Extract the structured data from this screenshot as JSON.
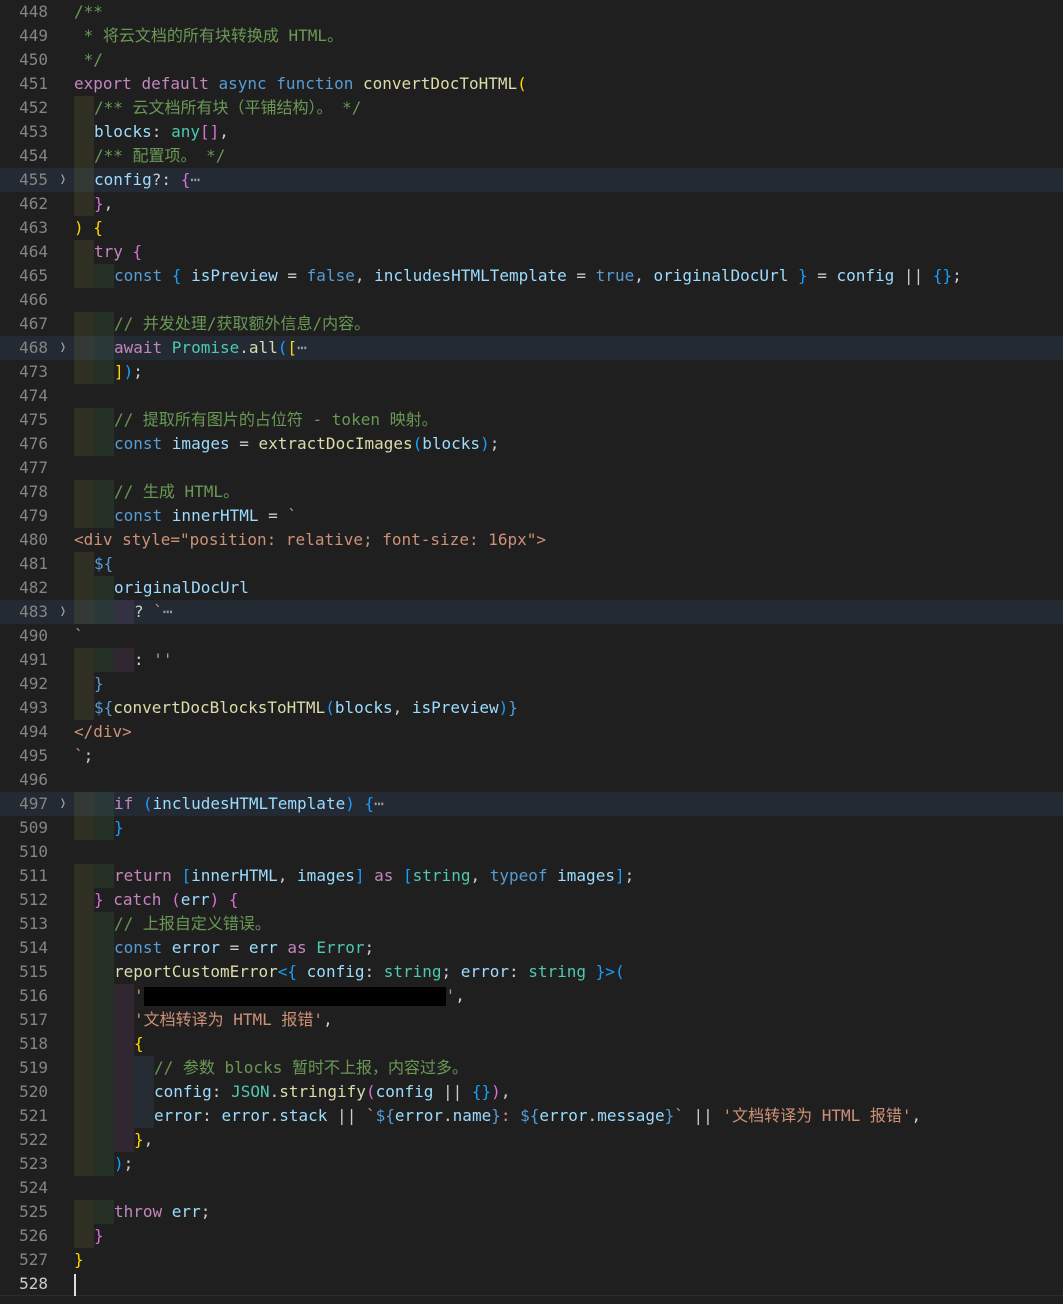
{
  "colors": {
    "background": "#1f1f1f",
    "keyword": "#c586c0",
    "keyword_blue": "#569cd6",
    "function": "#dcdcaa",
    "variable": "#9cdcfe",
    "type": "#4ec9b0",
    "string": "#ce9178",
    "comment": "#6a9955",
    "punct": "#cccccc",
    "bracket_gold": "#ffd700",
    "bracket_purple": "#da70d6",
    "bracket_blue": "#179fff",
    "tag": "#808080",
    "attr": "#9cdcfe"
  },
  "icons": {
    "fold": "chevron-right-icon",
    "folded_marker": "ellipsis-icon"
  },
  "lines": [
    {
      "n": "448",
      "fold": false,
      "indent": 0,
      "tokens": [
        [
          "/**",
          "comment"
        ]
      ]
    },
    {
      "n": "449",
      "fold": false,
      "indent": 0,
      "tokens": [
        [
          " * 将云文档的所有块转换成 HTML。",
          "comment"
        ]
      ]
    },
    {
      "n": "450",
      "fold": false,
      "indent": 0,
      "tokens": [
        [
          " */",
          "comment"
        ]
      ]
    },
    {
      "n": "451",
      "fold": false,
      "indent": 0,
      "tokens": [
        [
          "export ",
          "keyword"
        ],
        [
          "default ",
          "keyword"
        ],
        [
          "async ",
          "keyword_blue"
        ],
        [
          "function ",
          "keyword_blue"
        ],
        [
          "convertDocToHTML",
          "function"
        ],
        [
          "(",
          "bracket_gold"
        ]
      ]
    },
    {
      "n": "452",
      "fold": false,
      "indent": 1,
      "tokens": [
        [
          "/** 云文档所有块（平铺结构）。 */",
          "comment"
        ]
      ]
    },
    {
      "n": "453",
      "fold": false,
      "indent": 1,
      "tokens": [
        [
          "blocks",
          "variable"
        ],
        [
          ": ",
          "punct"
        ],
        [
          "any",
          "type"
        ],
        [
          "[]",
          "bracket_purple"
        ],
        [
          ",",
          "punct"
        ]
      ]
    },
    {
      "n": "454",
      "fold": false,
      "indent": 1,
      "tokens": [
        [
          "/** 配置项。 */",
          "comment"
        ]
      ]
    },
    {
      "n": "455",
      "fold": true,
      "indent": 1,
      "tokens": [
        [
          "config",
          "variable"
        ],
        [
          "?: ",
          "punct"
        ],
        [
          "{",
          "bracket_purple"
        ],
        [
          "⋯",
          "ellipsis"
        ]
      ]
    },
    {
      "n": "462",
      "fold": false,
      "indent": 1,
      "tokens": [
        [
          "}",
          "bracket_purple"
        ],
        [
          ",",
          "punct"
        ]
      ]
    },
    {
      "n": "463",
      "fold": false,
      "indent": 0,
      "tokens": [
        [
          ")",
          "bracket_gold"
        ],
        [
          " ",
          "punct"
        ],
        [
          "{",
          "bracket_gold"
        ]
      ]
    },
    {
      "n": "464",
      "fold": false,
      "indent": 1,
      "tokens": [
        [
          "try ",
          "keyword"
        ],
        [
          "{",
          "bracket_purple"
        ]
      ]
    },
    {
      "n": "465",
      "fold": false,
      "indent": 2,
      "tokens": [
        [
          "const ",
          "keyword_blue"
        ],
        [
          "{ ",
          "bracket_blue"
        ],
        [
          "isPreview",
          "variable"
        ],
        [
          " = ",
          "punct"
        ],
        [
          "false",
          "keyword_blue"
        ],
        [
          ", ",
          "punct"
        ],
        [
          "includesHTMLTemplate",
          "variable"
        ],
        [
          " = ",
          "punct"
        ],
        [
          "true",
          "keyword_blue"
        ],
        [
          ", ",
          "punct"
        ],
        [
          "originalDocUrl",
          "variable"
        ],
        [
          " }",
          "bracket_blue"
        ],
        [
          " = ",
          "punct"
        ],
        [
          "config",
          "variable"
        ],
        [
          " || ",
          "punct"
        ],
        [
          "{}",
          "bracket_blue"
        ],
        [
          ";",
          "punct"
        ]
      ]
    },
    {
      "n": "466",
      "fold": false,
      "indent": 0,
      "tokens": []
    },
    {
      "n": "467",
      "fold": false,
      "indent": 2,
      "tokens": [
        [
          "// 并发处理/获取额外信息/内容。",
          "comment"
        ]
      ]
    },
    {
      "n": "468",
      "fold": true,
      "indent": 2,
      "tokens": [
        [
          "await ",
          "keyword"
        ],
        [
          "Promise",
          "type"
        ],
        [
          ".",
          "punct"
        ],
        [
          "all",
          "function"
        ],
        [
          "(",
          "bracket_blue"
        ],
        [
          "[",
          "bracket_gold"
        ],
        [
          "⋯",
          "ellipsis"
        ]
      ]
    },
    {
      "n": "473",
      "fold": false,
      "indent": 2,
      "tokens": [
        [
          "]",
          "bracket_gold"
        ],
        [
          ")",
          "bracket_blue"
        ],
        [
          ";",
          "punct"
        ]
      ]
    },
    {
      "n": "474",
      "fold": false,
      "indent": 0,
      "tokens": []
    },
    {
      "n": "475",
      "fold": false,
      "indent": 2,
      "tokens": [
        [
          "// 提取所有图片的占位符 - token 映射。",
          "comment"
        ]
      ]
    },
    {
      "n": "476",
      "fold": false,
      "indent": 2,
      "tokens": [
        [
          "const ",
          "keyword_blue"
        ],
        [
          "images",
          "variable"
        ],
        [
          " = ",
          "punct"
        ],
        [
          "extractDocImages",
          "function"
        ],
        [
          "(",
          "bracket_blue"
        ],
        [
          "blocks",
          "variable"
        ],
        [
          ")",
          "bracket_blue"
        ],
        [
          ";",
          "punct"
        ]
      ]
    },
    {
      "n": "477",
      "fold": false,
      "indent": 0,
      "tokens": []
    },
    {
      "n": "478",
      "fold": false,
      "indent": 2,
      "tokens": [
        [
          "// 生成 HTML。",
          "comment"
        ]
      ]
    },
    {
      "n": "479",
      "fold": false,
      "indent": 2,
      "tokens": [
        [
          "const ",
          "keyword_blue"
        ],
        [
          "innerHTML",
          "variable"
        ],
        [
          " = ",
          "punct"
        ],
        [
          "`",
          "string"
        ]
      ]
    },
    {
      "n": "480",
      "fold": false,
      "indent": 0,
      "tokens": [
        [
          "<div style=\"position: relative; font-size: 16px\">",
          "string"
        ]
      ]
    },
    {
      "n": "481",
      "fold": false,
      "indent": 1,
      "tokens": [
        [
          "${",
          "keyword_blue"
        ]
      ]
    },
    {
      "n": "482",
      "fold": false,
      "indent": 2,
      "tokens": [
        [
          "originalDocUrl",
          "variable"
        ]
      ]
    },
    {
      "n": "483",
      "fold": true,
      "indent": 3,
      "tokens": [
        [
          "? ",
          "punct"
        ],
        [
          "`",
          "string"
        ],
        [
          "⋯",
          "ellipsis"
        ]
      ]
    },
    {
      "n": "490",
      "fold": false,
      "indent": 0,
      "tokens": [
        [
          "`",
          "string"
        ]
      ]
    },
    {
      "n": "491",
      "fold": false,
      "indent": 3,
      "tokens": [
        [
          ": ",
          "punct"
        ],
        [
          "''",
          "string"
        ]
      ]
    },
    {
      "n": "492",
      "fold": false,
      "indent": 1,
      "tokens": [
        [
          "}",
          "keyword_blue"
        ]
      ]
    },
    {
      "n": "493",
      "fold": false,
      "indent": 1,
      "tokens": [
        [
          "${",
          "keyword_blue"
        ],
        [
          "convertDocBlocksToHTML",
          "function"
        ],
        [
          "(",
          "bracket_blue"
        ],
        [
          "blocks",
          "variable"
        ],
        [
          ", ",
          "punct"
        ],
        [
          "isPreview",
          "variable"
        ],
        [
          ")",
          "bracket_blue"
        ],
        [
          "}",
          "keyword_blue"
        ]
      ]
    },
    {
      "n": "494",
      "fold": false,
      "indent": 0,
      "tokens": [
        [
          "</div>",
          "string"
        ]
      ]
    },
    {
      "n": "495",
      "fold": false,
      "indent": 0,
      "tokens": [
        [
          "`",
          "string"
        ],
        [
          ";",
          "punct"
        ]
      ]
    },
    {
      "n": "496",
      "fold": false,
      "indent": 0,
      "tokens": []
    },
    {
      "n": "497",
      "fold": true,
      "indent": 2,
      "tokens": [
        [
          "if ",
          "keyword"
        ],
        [
          "(",
          "bracket_blue"
        ],
        [
          "includesHTMLTemplate",
          "variable"
        ],
        [
          ") ",
          "bracket_blue"
        ],
        [
          "{",
          "bracket_blue"
        ],
        [
          "⋯",
          "ellipsis"
        ]
      ]
    },
    {
      "n": "509",
      "fold": false,
      "indent": 2,
      "tokens": [
        [
          "}",
          "bracket_blue"
        ]
      ]
    },
    {
      "n": "510",
      "fold": false,
      "indent": 0,
      "tokens": []
    },
    {
      "n": "511",
      "fold": false,
      "indent": 2,
      "tokens": [
        [
          "return ",
          "keyword"
        ],
        [
          "[",
          "bracket_blue"
        ],
        [
          "innerHTML",
          "variable"
        ],
        [
          ", ",
          "punct"
        ],
        [
          "images",
          "variable"
        ],
        [
          "]",
          "bracket_blue"
        ],
        [
          " as ",
          "keyword"
        ],
        [
          "[",
          "bracket_blue"
        ],
        [
          "string",
          "type"
        ],
        [
          ", ",
          "punct"
        ],
        [
          "typeof ",
          "keyword_blue"
        ],
        [
          "images",
          "variable"
        ],
        [
          "]",
          "bracket_blue"
        ],
        [
          ";",
          "punct"
        ]
      ]
    },
    {
      "n": "512",
      "fold": false,
      "indent": 1,
      "tokens": [
        [
          "} ",
          "bracket_purple"
        ],
        [
          "catch ",
          "keyword"
        ],
        [
          "(",
          "bracket_purple"
        ],
        [
          "err",
          "variable"
        ],
        [
          ") ",
          "bracket_purple"
        ],
        [
          "{",
          "bracket_purple"
        ]
      ]
    },
    {
      "n": "513",
      "fold": false,
      "indent": 2,
      "tokens": [
        [
          "// 上报自定义错误。",
          "comment"
        ]
      ]
    },
    {
      "n": "514",
      "fold": false,
      "indent": 2,
      "tokens": [
        [
          "const ",
          "keyword_blue"
        ],
        [
          "error",
          "variable"
        ],
        [
          " = ",
          "punct"
        ],
        [
          "err",
          "variable"
        ],
        [
          " as ",
          "keyword"
        ],
        [
          "Error",
          "type"
        ],
        [
          ";",
          "punct"
        ]
      ]
    },
    {
      "n": "515",
      "fold": false,
      "indent": 2,
      "tokens": [
        [
          "reportCustomError",
          "function"
        ],
        [
          "<{ ",
          "bracket_blue"
        ],
        [
          "config",
          "variable"
        ],
        [
          ": ",
          "punct"
        ],
        [
          "string",
          "type"
        ],
        [
          "; ",
          "punct"
        ],
        [
          "error",
          "variable"
        ],
        [
          ": ",
          "punct"
        ],
        [
          "string",
          "type"
        ],
        [
          " }>",
          "bracket_blue"
        ],
        [
          "(",
          "bracket_blue"
        ]
      ]
    },
    {
      "n": "516",
      "fold": false,
      "indent": 3,
      "tokens": [
        [
          "'",
          "string"
        ],
        [
          "REDACTED",
          "redact"
        ],
        [
          "'",
          "string"
        ],
        [
          ",",
          "punct"
        ]
      ]
    },
    {
      "n": "517",
      "fold": false,
      "indent": 3,
      "tokens": [
        [
          "'文档转译为 HTML 报错'",
          "string"
        ],
        [
          ",",
          "punct"
        ]
      ]
    },
    {
      "n": "518",
      "fold": false,
      "indent": 3,
      "tokens": [
        [
          "{",
          "bracket_gold"
        ]
      ]
    },
    {
      "n": "519",
      "fold": false,
      "indent": 4,
      "tokens": [
        [
          "// 参数 blocks 暂时不上报，内容过多。",
          "comment"
        ]
      ]
    },
    {
      "n": "520",
      "fold": false,
      "indent": 4,
      "tokens": [
        [
          "config",
          "variable"
        ],
        [
          ": ",
          "punct"
        ],
        [
          "JSON",
          "type"
        ],
        [
          ".",
          "punct"
        ],
        [
          "stringify",
          "function"
        ],
        [
          "(",
          "bracket_purple"
        ],
        [
          "config",
          "variable"
        ],
        [
          " || ",
          "punct"
        ],
        [
          "{}",
          "bracket_blue"
        ],
        [
          ")",
          "bracket_purple"
        ],
        [
          ",",
          "punct"
        ]
      ]
    },
    {
      "n": "521",
      "fold": false,
      "indent": 4,
      "tokens": [
        [
          "error",
          "variable"
        ],
        [
          ": ",
          "punct"
        ],
        [
          "error",
          "variable"
        ],
        [
          ".",
          "punct"
        ],
        [
          "stack",
          "variable"
        ],
        [
          " || ",
          "punct"
        ],
        [
          "`",
          "string"
        ],
        [
          "${",
          "keyword_blue"
        ],
        [
          "error",
          "variable"
        ],
        [
          ".",
          "punct"
        ],
        [
          "name",
          "variable"
        ],
        [
          "}",
          "keyword_blue"
        ],
        [
          ": ",
          "string"
        ],
        [
          "${",
          "keyword_blue"
        ],
        [
          "error",
          "variable"
        ],
        [
          ".",
          "punct"
        ],
        [
          "message",
          "variable"
        ],
        [
          "}",
          "keyword_blue"
        ],
        [
          "`",
          "string"
        ],
        [
          " || ",
          "punct"
        ],
        [
          "'文档转译为 HTML 报错'",
          "string"
        ],
        [
          ",",
          "punct"
        ]
      ]
    },
    {
      "n": "522",
      "fold": false,
      "indent": 3,
      "tokens": [
        [
          "}",
          "bracket_gold"
        ],
        [
          ",",
          "punct"
        ]
      ]
    },
    {
      "n": "523",
      "fold": false,
      "indent": 2,
      "tokens": [
        [
          ")",
          "bracket_blue"
        ],
        [
          ";",
          "punct"
        ]
      ]
    },
    {
      "n": "524",
      "fold": false,
      "indent": 0,
      "tokens": []
    },
    {
      "n": "525",
      "fold": false,
      "indent": 2,
      "tokens": [
        [
          "throw ",
          "keyword"
        ],
        [
          "err",
          "variable"
        ],
        [
          ";",
          "punct"
        ]
      ]
    },
    {
      "n": "526",
      "fold": false,
      "indent": 1,
      "tokens": [
        [
          "}",
          "bracket_purple"
        ]
      ]
    },
    {
      "n": "527",
      "fold": false,
      "indent": 0,
      "tokens": [
        [
          "}",
          "bracket_gold"
        ]
      ]
    },
    {
      "n": "528",
      "fold": false,
      "indent": 0,
      "current": true,
      "tokens": []
    }
  ]
}
